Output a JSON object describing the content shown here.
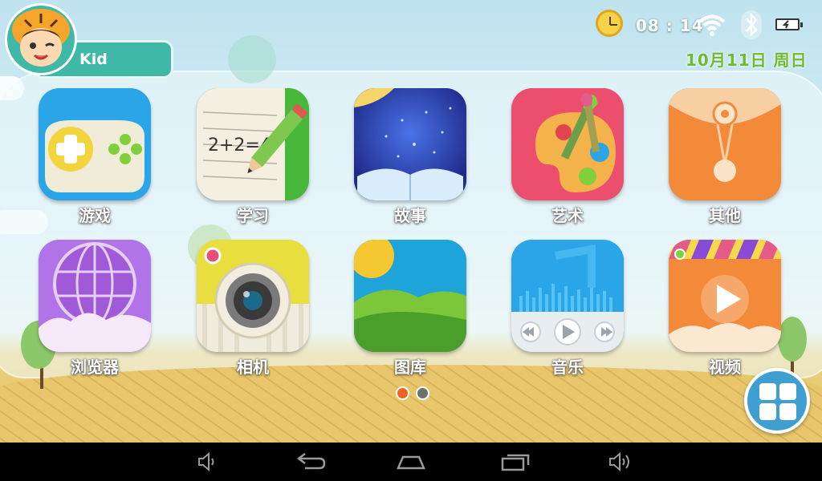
{
  "profile": {
    "name": "Kid"
  },
  "status": {
    "time": "08 : 14",
    "date": "10月11日  周日"
  },
  "apps": [
    {
      "label": "游戏"
    },
    {
      "label": "学习"
    },
    {
      "label": "故事"
    },
    {
      "label": "艺术"
    },
    {
      "label": "其他"
    },
    {
      "label": "浏览器"
    },
    {
      "label": "相机"
    },
    {
      "label": "图库"
    },
    {
      "label": "音乐"
    },
    {
      "label": "视频"
    }
  ],
  "pager": {
    "current": 1,
    "total": 2
  },
  "colors": {
    "accent": "#3fb8a8",
    "active_dot": "#f0641e",
    "inactive_dot": "#707070",
    "date": "#6dbb32"
  },
  "icons": {
    "wifi": "wifi-icon",
    "bluetooth": "bluetooth-icon",
    "battery": "battery-icon",
    "clock": "clock-icon"
  }
}
